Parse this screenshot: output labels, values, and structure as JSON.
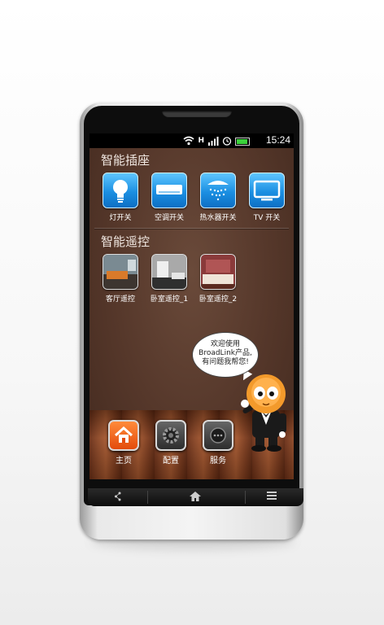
{
  "status_bar": {
    "time": "15:24",
    "icons": [
      "wifi-icon",
      "network-h-icon",
      "signal-icon",
      "alarm-icon",
      "battery-icon"
    ]
  },
  "sections": [
    {
      "title": "智能插座",
      "items": [
        {
          "label": "灯开关",
          "icon": "lightbulb-icon"
        },
        {
          "label": "空调开关",
          "icon": "air-conditioner-icon"
        },
        {
          "label": "热水器开关",
          "icon": "shower-icon"
        },
        {
          "label": "TV 开关",
          "icon": "tv-icon"
        }
      ]
    },
    {
      "title": "智能遥控",
      "items": [
        {
          "label": "客厅遥控",
          "icon": "living-room-photo"
        },
        {
          "label": "卧室遥控_1",
          "icon": "bedroom-photo-1"
        },
        {
          "label": "卧室遥控_2",
          "icon": "bedroom-photo-2"
        }
      ]
    }
  ],
  "mascot": {
    "bubble_lines": [
      "欢迎使用",
      "BroadLink产品,",
      "有问题我帮您!"
    ]
  },
  "bottom_nav": [
    {
      "label": "主页",
      "icon": "home-icon",
      "active": true
    },
    {
      "label": "配置",
      "icon": "gear-icon",
      "active": false
    },
    {
      "label": "服务",
      "icon": "chat-icon",
      "active": false
    }
  ],
  "hardware_keys": [
    "share-icon",
    "home-icon",
    "menu-icon"
  ],
  "colors": {
    "accent_blue": "#1b8fe2",
    "active_orange": "#e34b0c",
    "screen_brown": "#55372a"
  }
}
